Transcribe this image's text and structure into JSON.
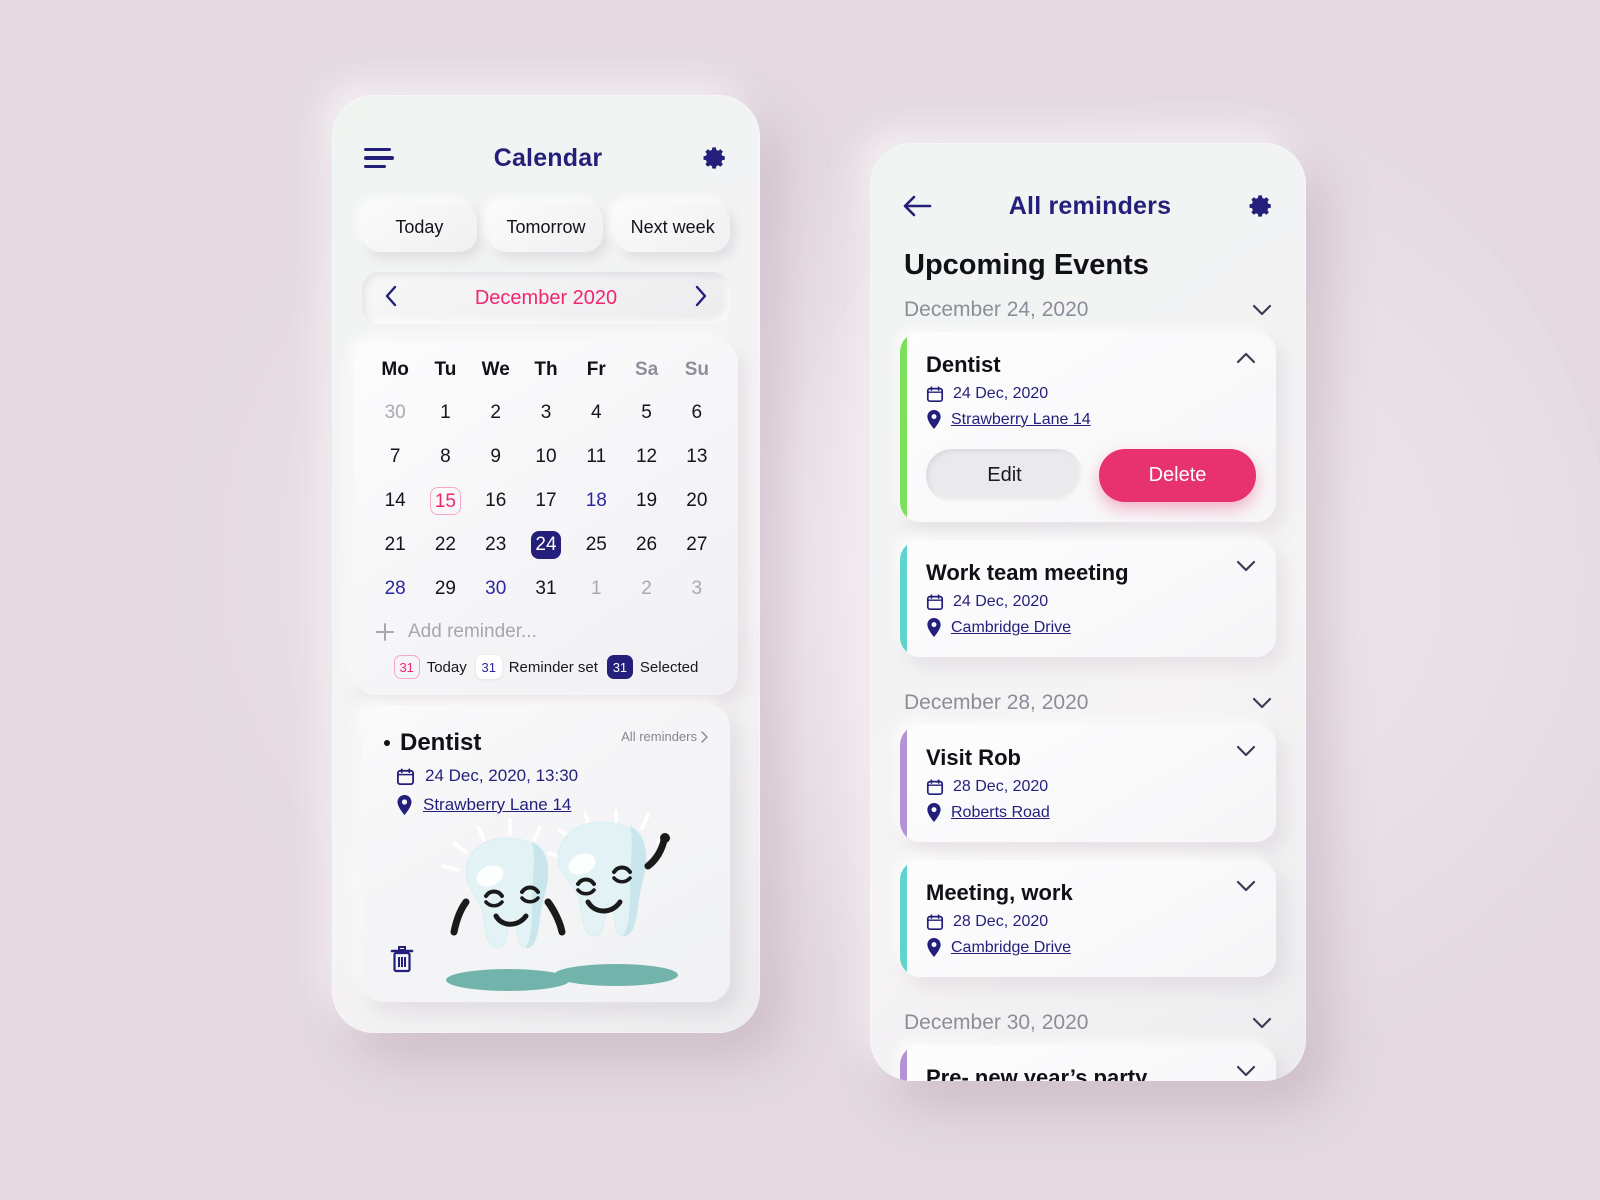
{
  "colors": {
    "background": "#e4d9e1",
    "navy": "#231f7a",
    "pink": "#f0266f",
    "delete_pink": "#e83270",
    "muted": "#8d8d9a"
  },
  "left_phone": {
    "header": {
      "menu_icon": "hamburger-icon",
      "title": "Calendar",
      "settings_icon": "gear-icon"
    },
    "quick_chips": [
      "Today",
      "Tomorrow",
      "Next week"
    ],
    "month_nav": {
      "prev_icon": "chevron-left-icon",
      "label": "December 2020",
      "next_icon": "chevron-right-icon"
    },
    "calendar": {
      "dow": [
        "Mo",
        "Tu",
        "We",
        "Th",
        "Fr",
        "Sa",
        "Su"
      ],
      "weekend_index": [
        5,
        6
      ],
      "weeks": [
        [
          {
            "d": "30",
            "s": "muted"
          },
          {
            "d": "1",
            "s": ""
          },
          {
            "d": "2",
            "s": ""
          },
          {
            "d": "3",
            "s": ""
          },
          {
            "d": "4",
            "s": ""
          },
          {
            "d": "5",
            "s": ""
          },
          {
            "d": "6",
            "s": ""
          }
        ],
        [
          {
            "d": "7",
            "s": ""
          },
          {
            "d": "8",
            "s": ""
          },
          {
            "d": "9",
            "s": ""
          },
          {
            "d": "10",
            "s": ""
          },
          {
            "d": "11",
            "s": ""
          },
          {
            "d": "12",
            "s": ""
          },
          {
            "d": "13",
            "s": ""
          }
        ],
        [
          {
            "d": "14",
            "s": ""
          },
          {
            "d": "15",
            "s": "today"
          },
          {
            "d": "16",
            "s": ""
          },
          {
            "d": "17",
            "s": ""
          },
          {
            "d": "18",
            "s": "rem"
          },
          {
            "d": "19",
            "s": ""
          },
          {
            "d": "20",
            "s": ""
          }
        ],
        [
          {
            "d": "21",
            "s": ""
          },
          {
            "d": "22",
            "s": ""
          },
          {
            "d": "23",
            "s": ""
          },
          {
            "d": "24",
            "s": "selected"
          },
          {
            "d": "25",
            "s": ""
          },
          {
            "d": "26",
            "s": ""
          },
          {
            "d": "27",
            "s": ""
          }
        ],
        [
          {
            "d": "28",
            "s": "rem"
          },
          {
            "d": "29",
            "s": ""
          },
          {
            "d": "30",
            "s": "rem"
          },
          {
            "d": "31",
            "s": ""
          },
          {
            "d": "1",
            "s": "muted"
          },
          {
            "d": "2",
            "s": "muted"
          },
          {
            "d": "3",
            "s": "muted"
          }
        ]
      ],
      "add_reminder": "Add reminder...",
      "legend": [
        {
          "badge": "31",
          "label": "Today",
          "style": "lg-today"
        },
        {
          "badge": "31",
          "label": "Reminder set",
          "style": "lg-rem"
        },
        {
          "badge": "31",
          "label": "Selected",
          "style": "lg-sel"
        }
      ]
    },
    "dentist_card": {
      "title": "Dentist",
      "all_reminders": "All reminders",
      "date": "24 Dec, 2020, 13:30",
      "location": "Strawberry Lane 14",
      "calendar_icon": "calendar-icon",
      "pin_icon": "map-pin-icon",
      "delete_icon": "trash-icon",
      "illustration": "two-happy-teeth-illustration"
    }
  },
  "right_phone": {
    "header": {
      "back_icon": "arrow-left-icon",
      "title": "All reminders",
      "settings_icon": "gear-icon"
    },
    "page_title": "Upcoming Events",
    "groups": [
      {
        "date": "December 24, 2020",
        "chevron": "chevron-down-icon",
        "events": [
          {
            "title": "Dentist",
            "date": "24 Dec, 2020",
            "location": "Strawberry Lane 14",
            "accent": "#7de05a",
            "expanded": true,
            "chevron": "chevron-up-icon",
            "edit_label": "Edit",
            "delete_label": "Delete"
          },
          {
            "title": "Work team meeting",
            "date": "24 Dec, 2020",
            "location": "Cambridge Drive",
            "accent": "#5fd3cd",
            "expanded": false,
            "chevron": "chevron-down-icon"
          }
        ]
      },
      {
        "date": "December 28, 2020",
        "chevron": "chevron-down-icon",
        "events": [
          {
            "title": "Visit Rob",
            "date": "28 Dec, 2020",
            "location": "Roberts Road",
            "accent": "#b393d6",
            "expanded": false,
            "chevron": "chevron-down-icon"
          },
          {
            "title": "Meeting, work",
            "date": "28 Dec, 2020",
            "location": "Cambridge Drive",
            "accent": "#5fd3cd",
            "expanded": false,
            "chevron": "chevron-down-icon"
          }
        ]
      },
      {
        "date": "December 30, 2020",
        "chevron": "chevron-down-icon",
        "events": [
          {
            "title": "Pre- new year’s party",
            "date": "",
            "location": "",
            "accent": "#b393d6",
            "expanded": false,
            "chevron": "chevron-down-icon"
          }
        ]
      }
    ]
  }
}
